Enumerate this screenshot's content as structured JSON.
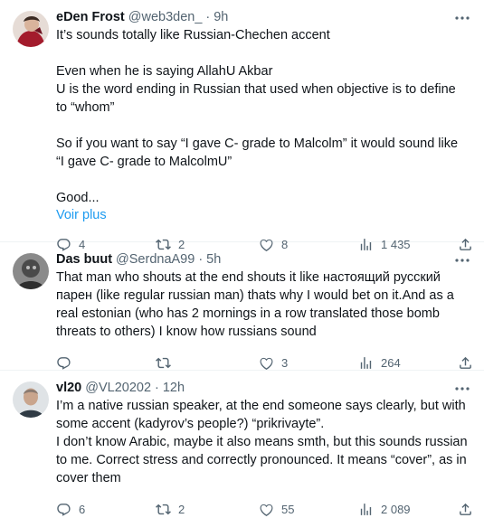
{
  "tweets": [
    {
      "name": "eDen Frost",
      "handle": "@web3den_",
      "time": "9h",
      "lines": [
        "It’s sounds totally like Russian-Chechen accent",
        "",
        "Even when he is saying AllahU Akbar",
        "U is the word ending in Russian that used when objective is to define to “whom”",
        "",
        "So if you want to say “I gave C- grade to Malcolm” it would sound like “I gave C- grade to MalcolmU”",
        "",
        "Good..."
      ],
      "show_more": "Voir plus",
      "replies": "4",
      "retweets": "2",
      "likes": "8",
      "views": "1 435"
    },
    {
      "name": "Das buut",
      "handle": "@SerdnaA99",
      "time": "5h",
      "lines": [
        "That man who shouts at the end shouts it like настоящий русский парен (like regular russian man) thats why I would bet on it.And as a real estonian (who has 2 mornings in a row translated those bomb threats to others) I know how russians sound"
      ],
      "replies": "",
      "retweets": "",
      "likes": "3",
      "views": "264"
    },
    {
      "name": "vl20",
      "handle": "@VL20202",
      "time": "12h",
      "lines": [
        "I’m a native russian speaker, at the end someone says clearly, but with some accent (kadyrov’s people?) “prikrivayte”.",
        "I don’t know Arabic, maybe it also means smth, but this sounds russian to me. Correct stress and correctly pronounced. It means “cover”, as in cover them"
      ],
      "replies": "6",
      "retweets": "2",
      "likes": "55",
      "views": "2 089"
    }
  ]
}
